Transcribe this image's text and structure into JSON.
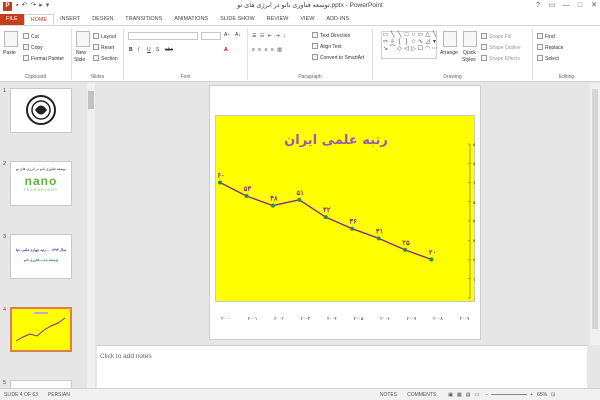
{
  "titlebar": {
    "app_icon": "P",
    "title": "توسعه فناوری نانو در انرژی های نو.pptx - PowerPoint",
    "qat_icons": [
      "save-icon",
      "undo-icon",
      "redo-icon",
      "start-icon",
      "customize-icon"
    ],
    "controls": [
      "?",
      "▭",
      "—",
      "□",
      "✕"
    ]
  },
  "tabs": [
    "FILE",
    "HOME",
    "INSERT",
    "DESIGN",
    "TRANSITIONS",
    "ANIMATIONS",
    "SLIDE SHOW",
    "REVIEW",
    "VIEW",
    "ADD-INS"
  ],
  "ribbon": {
    "clipboard": {
      "paste": "Paste",
      "cut": "Cut",
      "copy": "Copy",
      "format_painter": "Format Painter",
      "label": "Clipboard"
    },
    "slides": {
      "new_slide": "New",
      "new_slide_2": "Slide",
      "layout": "Layout",
      "reset": "Reset",
      "section": "Section",
      "label": "Slides"
    },
    "font": {
      "label": "Font",
      "bold": "B",
      "italic": "I",
      "underline": "U",
      "strike": "S",
      "shadow": "abc",
      "font_color": "A"
    },
    "paragraph": {
      "label": "Paragraph",
      "text_direction": "Text Direction",
      "align_text": "Align Text",
      "convert_smartart": "Convert to SmartArt"
    },
    "drawing": {
      "label": "Drawing",
      "arrange": "Arrange",
      "quick_styles": "Quick",
      "quick_styles_2": "Styles",
      "shape_fill": "Shape Fill",
      "shape_outline": "Shape Outline",
      "shape_effects": "Shape Effects"
    },
    "editing": {
      "label": "Editing",
      "find": "Find",
      "replace": "Replace",
      "select": "Select"
    }
  },
  "slides": [
    {
      "num": "1"
    },
    {
      "num": "2",
      "text": "توسعه فناوری نانو در انرژی های نو",
      "logo": "nano",
      "logo_sub": "TECHNOLOGY"
    },
    {
      "num": "3",
      "line1": "سال ۱۳۹۴ ← رتبه چهارم علمی دنیا",
      "line2": "توسعه جذب فناوری نانو"
    },
    {
      "num": "4"
    },
    {
      "num": "5"
    }
  ],
  "notes_placeholder": "Click to add notes",
  "status": {
    "slide_of": "SLIDE 4 OF 63",
    "language": "PERSIAN",
    "notes": "NOTES",
    "comments": "COMMENTS",
    "zoom": "65%"
  },
  "chart_data": {
    "type": "line",
    "title": "رتبه علمی ایران",
    "categories": [
      "۲۰۰۰",
      "۲۰۰۱",
      "۲۰۰۲",
      "۲۰۰۳",
      "۲۰۰۴",
      "۲۰۰۵",
      "۲۰۰۶",
      "۲۰۰۷",
      "۲۰۰۸"
    ],
    "x_ticks": [
      "۲۰۰۰",
      "۲۰۰۱",
      "۲۰۰۲",
      "۲۰۰۳",
      "۲۰۰۴",
      "۲۰۰۵",
      "۲۰۰۶",
      "۲۰۰۷",
      "۲۰۰۸",
      "۲۰۰۹"
    ],
    "values": [
      60,
      53,
      48,
      51,
      42,
      36,
      31,
      25,
      20
    ],
    "data_labels": [
      "۶۰",
      "۵۳",
      "۴۸",
      "۵۱",
      "۴۲",
      "۳۶",
      "۳۱",
      "۲۵",
      "۲۰"
    ],
    "y_ticks": [
      "۰",
      "۱۰",
      "۲۰",
      "۳۰",
      "۴۰",
      "۵۰",
      "۶۰",
      "۷۰",
      "۸۰"
    ],
    "ylim": [
      0,
      80
    ],
    "y_reversed": true,
    "color": "#8a2b8a",
    "marker_color": "#2e8b57",
    "title_color": "#9b59b6",
    "background": "#ffff00"
  }
}
